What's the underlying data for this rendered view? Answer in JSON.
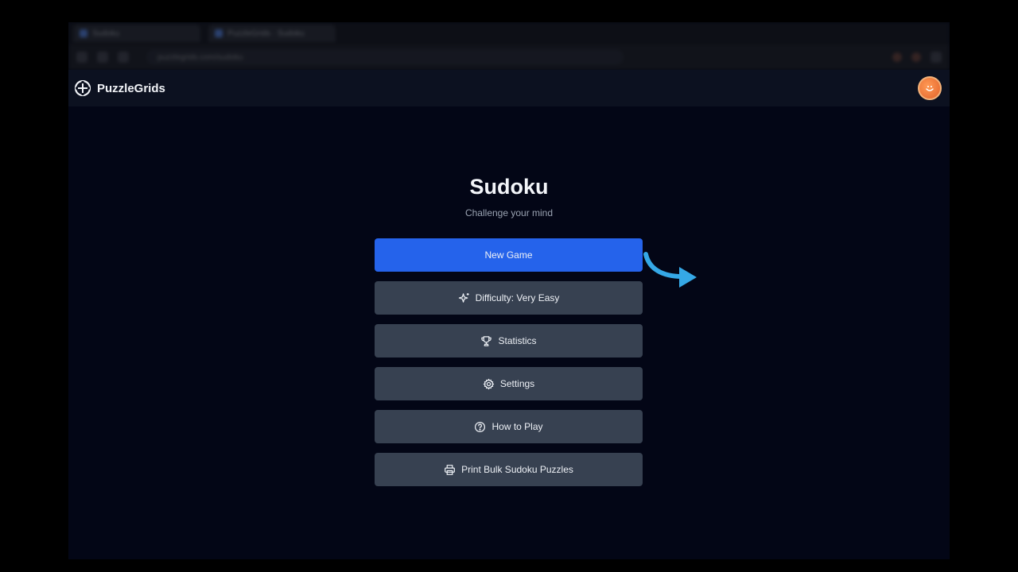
{
  "browser": {
    "tabs": [
      {
        "label": "Sudoku"
      },
      {
        "label": "PuzzleGrids · Sudoku"
      }
    ],
    "url": "puzzlegrids.com/sudoku"
  },
  "header": {
    "brand": "PuzzleGrids",
    "logo_icon": "puzzlegrids-logo-icon",
    "avatar_icon": "user-avatar-icon"
  },
  "main": {
    "title": "Sudoku",
    "subtitle": "Challenge your mind",
    "buttons": [
      {
        "label": "New Game",
        "icon": null
      },
      {
        "label": "Difficulty: Very Easy",
        "icon": "sparkle-icon"
      },
      {
        "label": "Statistics",
        "icon": "trophy-icon"
      },
      {
        "label": "Settings",
        "icon": "gear-icon"
      },
      {
        "label": "How to Play",
        "icon": "help-circle-icon"
      },
      {
        "label": "Print Bulk Sudoku Puzzles",
        "icon": "printer-icon"
      }
    ]
  },
  "colors": {
    "primary": "#2563eb",
    "button_bg": "#374151",
    "page_bg": "#030616",
    "header_bg": "#0c1120",
    "arrow": "#35a8e6"
  }
}
